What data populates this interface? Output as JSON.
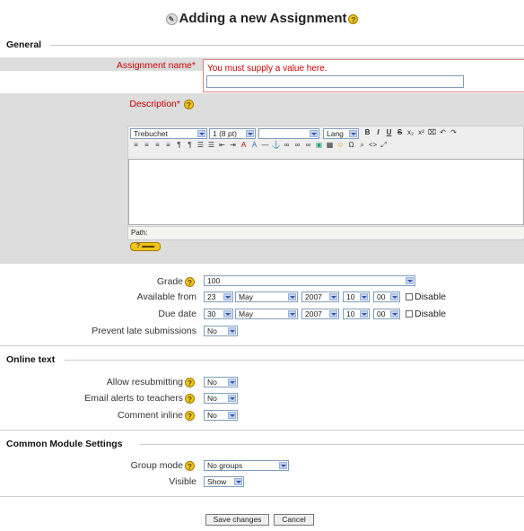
{
  "page": {
    "title": "Adding a new Assignment"
  },
  "sections": {
    "general": "General",
    "online_text": "Online text",
    "common": "Common Module Settings"
  },
  "assignment_name": {
    "label": "Assignment name",
    "required_mark": "*",
    "error": "You must supply a value here.",
    "value": ""
  },
  "description": {
    "label": "Description",
    "required_mark": "*",
    "editor": {
      "font": "Trebuchet",
      "size": "1 (8 pt)",
      "heading": "",
      "lang": "Lang",
      "path_label": "Path:"
    }
  },
  "grade": {
    "label": "Grade",
    "value": "100"
  },
  "available_from": {
    "label": "Available from",
    "day": "23",
    "month": "May",
    "year": "2007",
    "hour": "10",
    "minute": "00",
    "disable": "Disable"
  },
  "due_date": {
    "label": "Due date",
    "day": "30",
    "month": "May",
    "year": "2007",
    "hour": "10",
    "minute": "00",
    "disable": "Disable"
  },
  "prevent_late": {
    "label": "Prevent late submissions",
    "value": "No"
  },
  "allow_resubmitting": {
    "label": "Allow resubmitting",
    "value": "No"
  },
  "email_alerts": {
    "label": "Email alerts to teachers",
    "value": "No"
  },
  "comment_inline": {
    "label": "Comment inline",
    "value": "No"
  },
  "group_mode": {
    "label": "Group mode",
    "value": "No groups"
  },
  "visible": {
    "label": "Visible",
    "value": "Show"
  },
  "buttons": {
    "save": "Save changes",
    "cancel": "Cancel"
  },
  "colors": {
    "required": "#cc0000",
    "band": "#dddddd",
    "help": "#f0c419"
  },
  "icons": [
    "assignment-icon",
    "help-icon",
    "select-arrow-icon",
    "checkbox"
  ]
}
